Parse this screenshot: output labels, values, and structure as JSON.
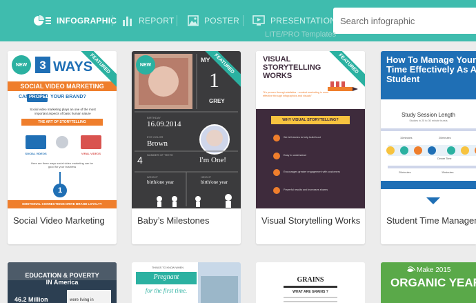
{
  "nav": {
    "items": [
      {
        "label": "INFOGRAPHIC",
        "icon": "infographic-icon",
        "active": true
      },
      {
        "label": "REPORT",
        "icon": "report-icon"
      },
      {
        "label": "POSTER",
        "icon": "poster-icon"
      },
      {
        "label": "PRESENTATION",
        "icon": "presentation-icon"
      }
    ],
    "search_placeholder": "Search infographic",
    "subcaption": "LITE/PRO Templates"
  },
  "badges": {
    "featured": "FEATURED",
    "new": "NEW"
  },
  "cards": [
    {
      "title": "Social Video Marketing",
      "thumb": {
        "heading": "3 WAYS",
        "banner": "SOCIAL VIDEO MARKETING",
        "line1": "CAN",
        "line2": "PROPEL",
        "line3": "YOUR BRAND?",
        "body": "Social video marketing plays an one of the most important aspects of basic human nature",
        "tag": "THE ART OF STORYTELLING",
        "left_label": "SOCIAL VIDEOS",
        "right_label": "VIRAL VIDEOS",
        "note": "Here are three ways social video marketing can be good for your business",
        "number": "1",
        "footer": "EMOTIONAL CONNECTIONS DRIVE BRAND LOYALTY"
      }
    },
    {
      "title": "Baby’s Milestones",
      "thumb": {
        "top_label": "MY",
        "number": "1",
        "sub_label": "GREY",
        "birthday_label": "BIRTHDAY",
        "date": "16.09.2014",
        "eye_label": "EYE COLOR",
        "eye": "Brown",
        "teeth_label": "NUMBER OF TEETH",
        "teeth": "4",
        "caption": "I'm One!",
        "weight_label": "WEIGHT",
        "weight": "birth/one year",
        "height_label": "HEIGHT",
        "height": "birth/one year"
      }
    },
    {
      "title": "Visual Storytelling Works",
      "thumb": {
        "heading": "VISUAL STORYTELLING WORKS",
        "quote": "\"It's proven through statistics - content marketing is more effective through infographics and visuals\"",
        "banner": "WHY VISUAL STORYTELLING?",
        "rows": [
          "We tell stories to help build trust",
          "Easy to understand",
          "Encourages greater engagement with customers",
          "Powerful results and increases shares"
        ]
      }
    },
    {
      "title": "Student Time Management",
      "thumb": {
        "heading": "How To Manage Your Time Effectively As A Student",
        "chart_title": "Study Session Length",
        "chart_sub": "Studies in 25 to 30 minute bursts",
        "labels": [
          "10minutes",
          "20minutes",
          "Dinner Time",
          "20minutes",
          "15minutes"
        ]
      }
    }
  ],
  "row2": [
    {
      "heading": "EDUCATION & POVERTY IN America",
      "figure": "46.2 Million",
      "note": "were living in"
    },
    {
      "heading": "THINGS TO KNOW WHEN",
      "banner": "Pregnant",
      "sub": "for the first time."
    },
    {
      "heading": "GRAINS",
      "sub": "WHAT ARE GRAINS ?"
    },
    {
      "heading": "Make 2015",
      "sub": "ORGANIC YEAR"
    }
  ],
  "colors": {
    "brand": "#3fbcae",
    "accent": "#2bb1a1",
    "orange": "#ef7e2c",
    "dark_slate": "#3b3b3d",
    "navy": "#1f6fb5"
  }
}
